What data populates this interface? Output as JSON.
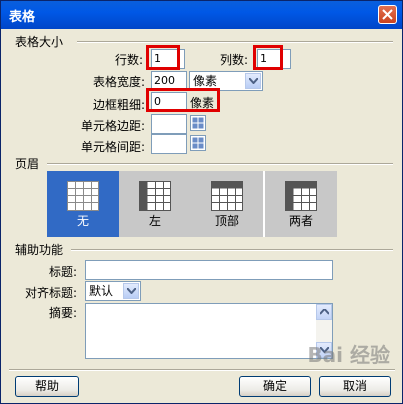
{
  "window": {
    "title": "表格"
  },
  "table_size": {
    "section_label": "表格大小",
    "rows_label": "行数:",
    "rows_value": "1",
    "cols_label": "列数:",
    "cols_value": "1",
    "width_label": "表格宽度:",
    "width_value": "200",
    "width_unit": "像素",
    "border_label": "边框粗细:",
    "border_value": "0",
    "border_unit": "像素",
    "padding_label": "单元格边距:",
    "padding_value": "",
    "spacing_label": "单元格间距:",
    "spacing_value": ""
  },
  "header": {
    "section_label": "页眉",
    "options": [
      {
        "label": "无",
        "selected": true
      },
      {
        "label": "左",
        "selected": false
      },
      {
        "label": "顶部",
        "selected": false
      },
      {
        "label": "两者",
        "selected": false
      }
    ]
  },
  "accessibility": {
    "section_label": "辅助功能",
    "caption_label": "标题:",
    "caption_value": "",
    "align_label": "对齐标题:",
    "align_value": "默认",
    "summary_label": "摘要:",
    "summary_value": ""
  },
  "buttons": {
    "help": "帮助",
    "ok": "确定",
    "cancel": "取消"
  },
  "watermark": "Bai 经验",
  "colors": {
    "titlebar": "#0058e6",
    "highlight": "#e00000",
    "selected": "#316ac5"
  }
}
